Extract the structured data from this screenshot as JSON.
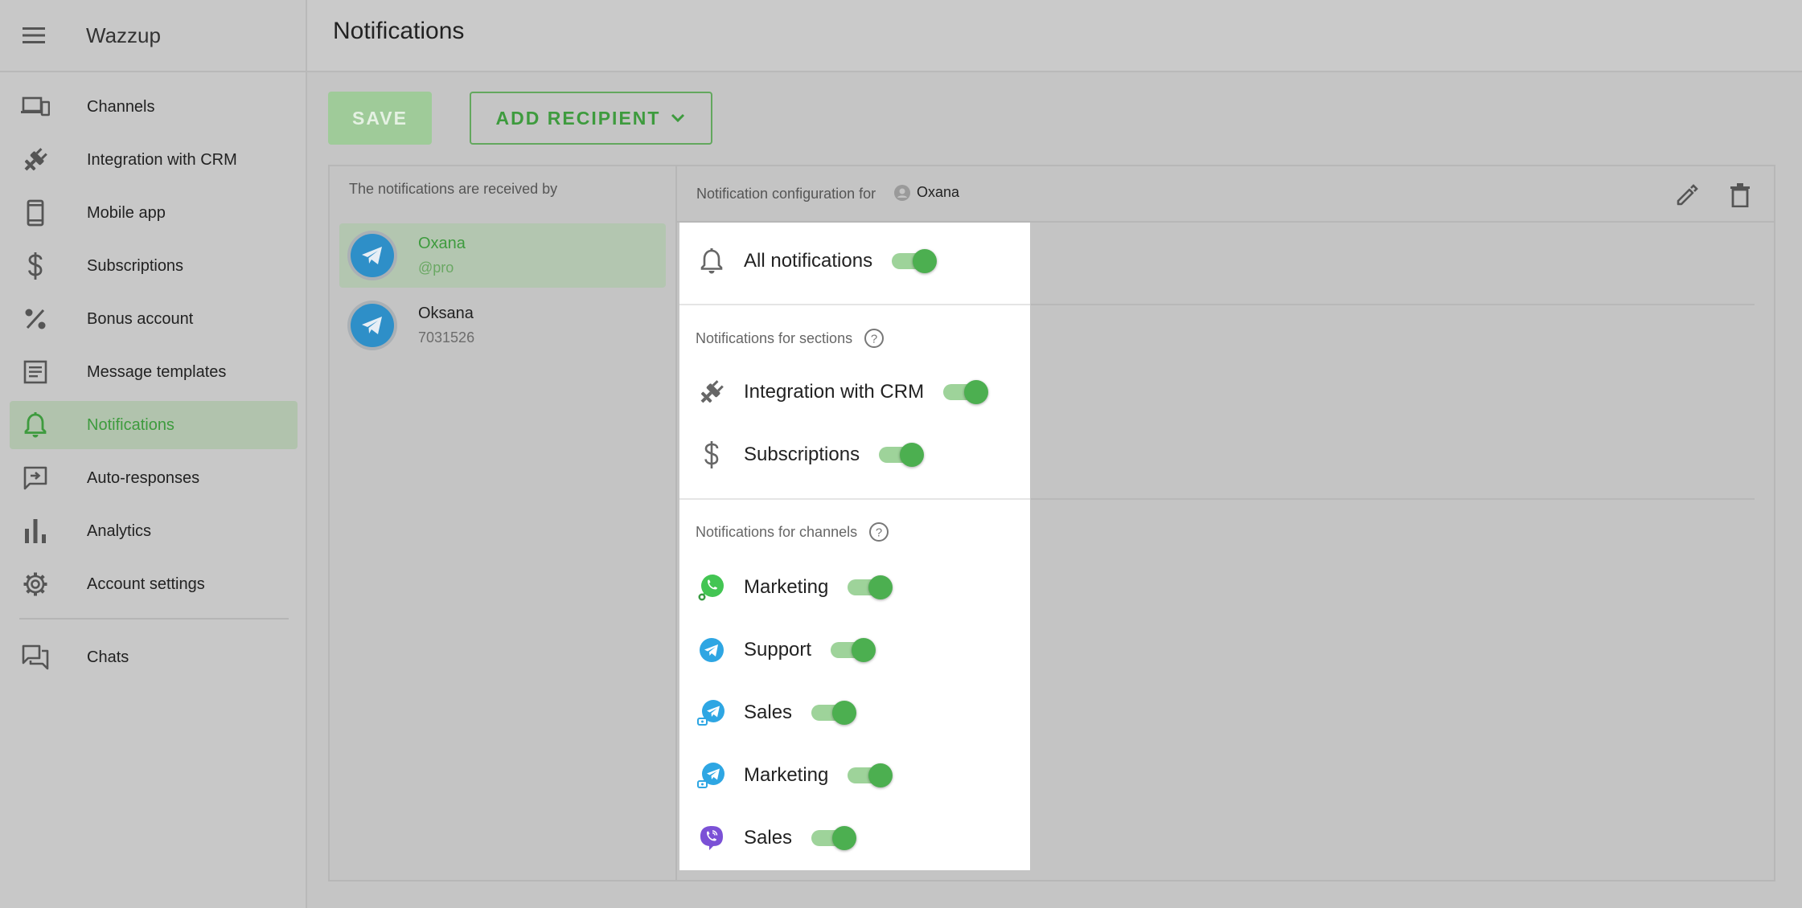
{
  "app": {
    "brand": "Wazzup"
  },
  "sidebar": {
    "items": [
      {
        "label": "Channels",
        "icon": "devices-icon",
        "active": false
      },
      {
        "label": "Integration with CRM",
        "icon": "plug-icon",
        "active": false
      },
      {
        "label": "Mobile app",
        "icon": "phone-icon",
        "active": false
      },
      {
        "label": "Subscriptions",
        "icon": "dollar-icon",
        "active": false
      },
      {
        "label": "Bonus account",
        "icon": "percent-icon",
        "active": false
      },
      {
        "label": "Message templates",
        "icon": "template-icon",
        "active": false
      },
      {
        "label": "Notifications",
        "icon": "bell-icon",
        "active": true
      },
      {
        "label": "Auto-responses",
        "icon": "auto-reply-icon",
        "active": false
      },
      {
        "label": "Analytics",
        "icon": "analytics-icon",
        "active": false
      },
      {
        "label": "Account settings",
        "icon": "gear-icon",
        "active": false
      }
    ],
    "bottom_items": [
      {
        "label": "Chats",
        "icon": "chats-icon",
        "active": false
      }
    ]
  },
  "header": {
    "title": "Notifications"
  },
  "toolbar": {
    "save_label": "SAVE",
    "add_recipient_label": "ADD RECIPIENT"
  },
  "recipients": {
    "title": "The notifications are received by",
    "items": [
      {
        "name": "Oxana",
        "sub": "@pro",
        "active": true
      },
      {
        "name": "Oksana",
        "sub": "7031526",
        "active": false
      }
    ]
  },
  "config": {
    "label": "Notification configuration for",
    "user": "Oxana",
    "all_notifications": {
      "label": "All notifications",
      "on": true
    },
    "sections_title": "Notifications for sections",
    "sections": [
      {
        "label": "Integration with CRM",
        "icon": "plug-icon",
        "on": true
      },
      {
        "label": "Subscriptions",
        "icon": "dollar-icon",
        "on": true
      }
    ],
    "channels_title": "Notifications for channels",
    "channels": [
      {
        "label": "Marketing",
        "icon": "whatsapp-icon",
        "on": true
      },
      {
        "label": "Support",
        "icon": "telegram-icon",
        "on": true
      },
      {
        "label": "Sales",
        "icon": "telegram-personal-icon",
        "on": true
      },
      {
        "label": "Marketing",
        "icon": "telegram-personal-icon",
        "on": true
      },
      {
        "label": "Sales",
        "icon": "viber-icon",
        "on": true
      }
    ]
  },
  "colors": {
    "accent": "#4caf50",
    "accent_text": "#3e9b3e",
    "telegram": "#2ea6e3",
    "viber": "#7b51d6",
    "whatsapp": "#43c553"
  }
}
